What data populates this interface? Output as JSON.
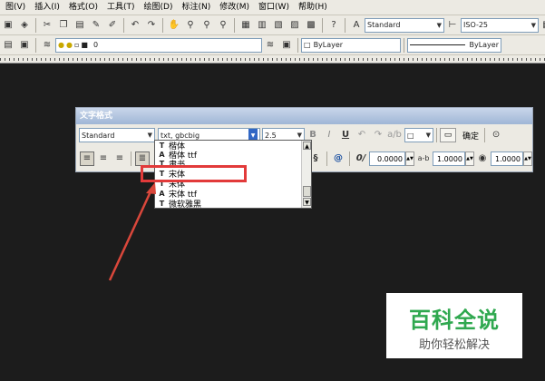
{
  "menubar": {
    "items": [
      "图(V)",
      "插入(I)",
      "格式(O)",
      "工具(T)",
      "绘图(D)",
      "标注(N)",
      "修改(M)",
      "窗口(W)",
      "帮助(H)"
    ]
  },
  "toolbar1": {
    "text_style": "Standard",
    "dim_style": "ISO-25"
  },
  "toolbar2": {
    "layer_value": "0",
    "color": "ByLayer",
    "linetype": "ByLayer"
  },
  "dialog": {
    "title": "文字格式",
    "style": "Standard",
    "font": "txt, gbcbig",
    "height": "2.5",
    "bold": "B",
    "italic": "I",
    "underline": "U",
    "ok": "确定",
    "obliquing": "0.0000",
    "tracking": "1.0000",
    "width_factor": "1.0000"
  },
  "font_list": {
    "items": [
      "楷体",
      "楷体 ttf",
      "隶书",
      "宋体",
      "宋体",
      "宋体 ttf",
      "微软雅黑"
    ],
    "highlighted_index": 3
  },
  "watermark": {
    "title": "百科全说",
    "subtitle": "助你轻松解决"
  }
}
